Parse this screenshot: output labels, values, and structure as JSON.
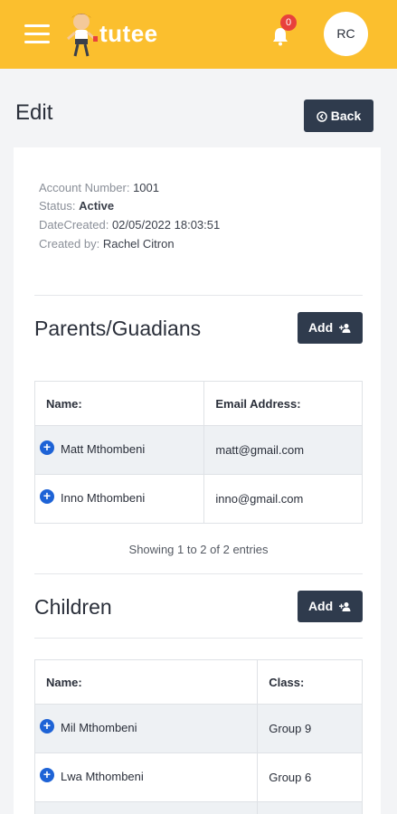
{
  "header": {
    "logo_text": "tutee",
    "notification_count": "0",
    "avatar_initials": "RC",
    "accent_color": "#fbbf2e"
  },
  "page": {
    "title": "Edit",
    "back_label": "Back"
  },
  "account": {
    "account_number_label": "Account Number:",
    "account_number": "1001",
    "status_label": "Status:",
    "status": "Active",
    "date_created_label": "DateCreated:",
    "date_created": "02/05/2022 18:03:51",
    "created_by_label": "Created by:",
    "created_by": "Rachel Citron"
  },
  "parents": {
    "title": "Parents/Guadians",
    "add_label": "Add",
    "columns": [
      "Name:",
      "Email Address:"
    ],
    "rows": [
      {
        "name": "Matt Mthombeni",
        "email": "matt@gmail.com"
      },
      {
        "name": "Inno Mthombeni",
        "email": "inno@gmail.com"
      }
    ],
    "entries_text": "Showing 1 to 2 of 2 entries"
  },
  "children": {
    "title": "Children",
    "add_label": "Add",
    "columns": [
      "Name:",
      "Class:"
    ],
    "rows": [
      {
        "name": "Mil Mthombeni",
        "class": "Group 9"
      },
      {
        "name": "Lwa Mthombeni",
        "class": "Group 6"
      }
    ]
  },
  "icons": {
    "menu": "hamburger-menu-icon",
    "bell": "bell-icon",
    "back": "back-circle-icon",
    "add": "add-user-icon",
    "expand": "plus-circle-icon"
  }
}
